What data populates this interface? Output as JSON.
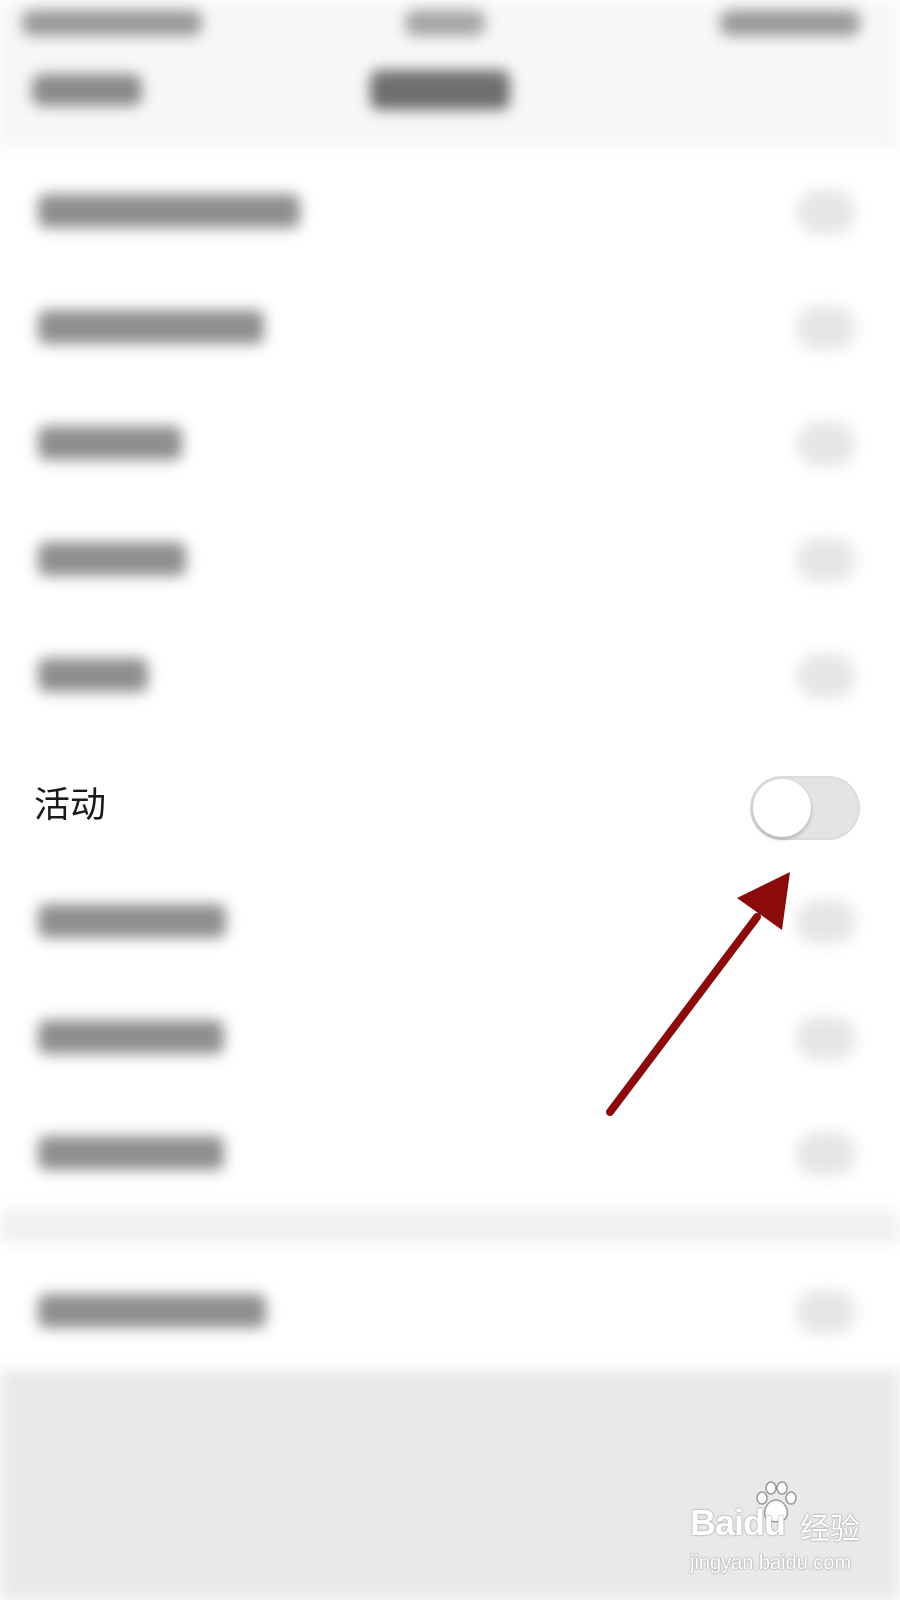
{
  "settings": {
    "activity_label": "活动",
    "activity_toggle_state": "off"
  },
  "watermark": {
    "brand": "Bai",
    "brand_suffix": "du",
    "product": "经验",
    "url": "jingyan.baidu.com"
  },
  "colors": {
    "arrow": "#8b0a0a",
    "toggle_off_track": "#e4e4e4",
    "footer_gray": "#e9e9e9"
  }
}
